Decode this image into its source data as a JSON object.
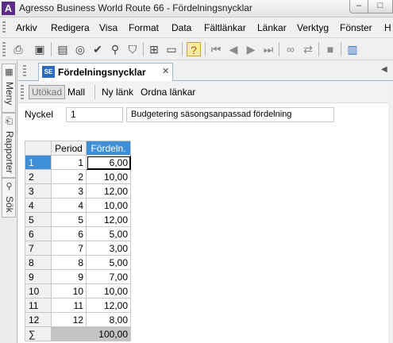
{
  "window": {
    "title": "Agresso Business World Route 66 - Fördelningsnycklar",
    "app_icon_letter": "A",
    "minimize_glyph": "–",
    "maximize_glyph": "□"
  },
  "menu": [
    "Arkiv",
    "Redigera",
    "Visa",
    "Format",
    "Data",
    "Fältlänkar",
    "Länkar",
    "Verktyg",
    "Fönster",
    "H"
  ],
  "toolbar": {
    "icons": [
      "print-icon",
      "save-icon",
      "open-folder-icon",
      "binoculars-icon",
      "checkmark-icon",
      "search-icon",
      "filter-icon",
      "insert-row-icon",
      "blank-form-icon",
      "help-icon",
      "first-record-icon",
      "previous-record-icon",
      "next-record-icon",
      "last-record-icon",
      "link-icon",
      "unlink-icon",
      "stop-icon",
      "chart-icon"
    ]
  },
  "sidebar": {
    "tabs": [
      {
        "label": "Meny",
        "icon": "menu-icon"
      },
      {
        "label": "Rapporter",
        "icon": "reports-icon"
      },
      {
        "label": "Sök",
        "icon": "search-icon"
      }
    ]
  },
  "document_tab": {
    "icon_text": "SE",
    "label": "Fördelningsnycklar",
    "close_glyph": "✕"
  },
  "subbar": {
    "extended_label": "Utökad",
    "template_label": "Mall",
    "new_link_label": "Ny länk",
    "arrange_links_label": "Ordna länkar"
  },
  "form": {
    "key_label": "Nyckel",
    "key_value": "1",
    "description_value": "Budgetering säsongsanpassad fördelning"
  },
  "grid": {
    "columns": [
      "Period",
      "Fördeln."
    ],
    "rows": [
      {
        "row": "1",
        "period": "1",
        "value": "6,00"
      },
      {
        "row": "2",
        "period": "2",
        "value": "10,00"
      },
      {
        "row": "3",
        "period": "3",
        "value": "12,00"
      },
      {
        "row": "4",
        "period": "4",
        "value": "10,00"
      },
      {
        "row": "5",
        "period": "5",
        "value": "12,00"
      },
      {
        "row": "6",
        "period": "6",
        "value": "5,00"
      },
      {
        "row": "7",
        "period": "7",
        "value": "3,00"
      },
      {
        "row": "8",
        "period": "8",
        "value": "5,00"
      },
      {
        "row": "9",
        "period": "9",
        "value": "7,00"
      },
      {
        "row": "10",
        "period": "10",
        "value": "10,00"
      },
      {
        "row": "11",
        "period": "11",
        "value": "12,00"
      },
      {
        "row": "12",
        "period": "12",
        "value": "8,00"
      }
    ],
    "sum_symbol": "∑",
    "sum_value": "100,00"
  }
}
